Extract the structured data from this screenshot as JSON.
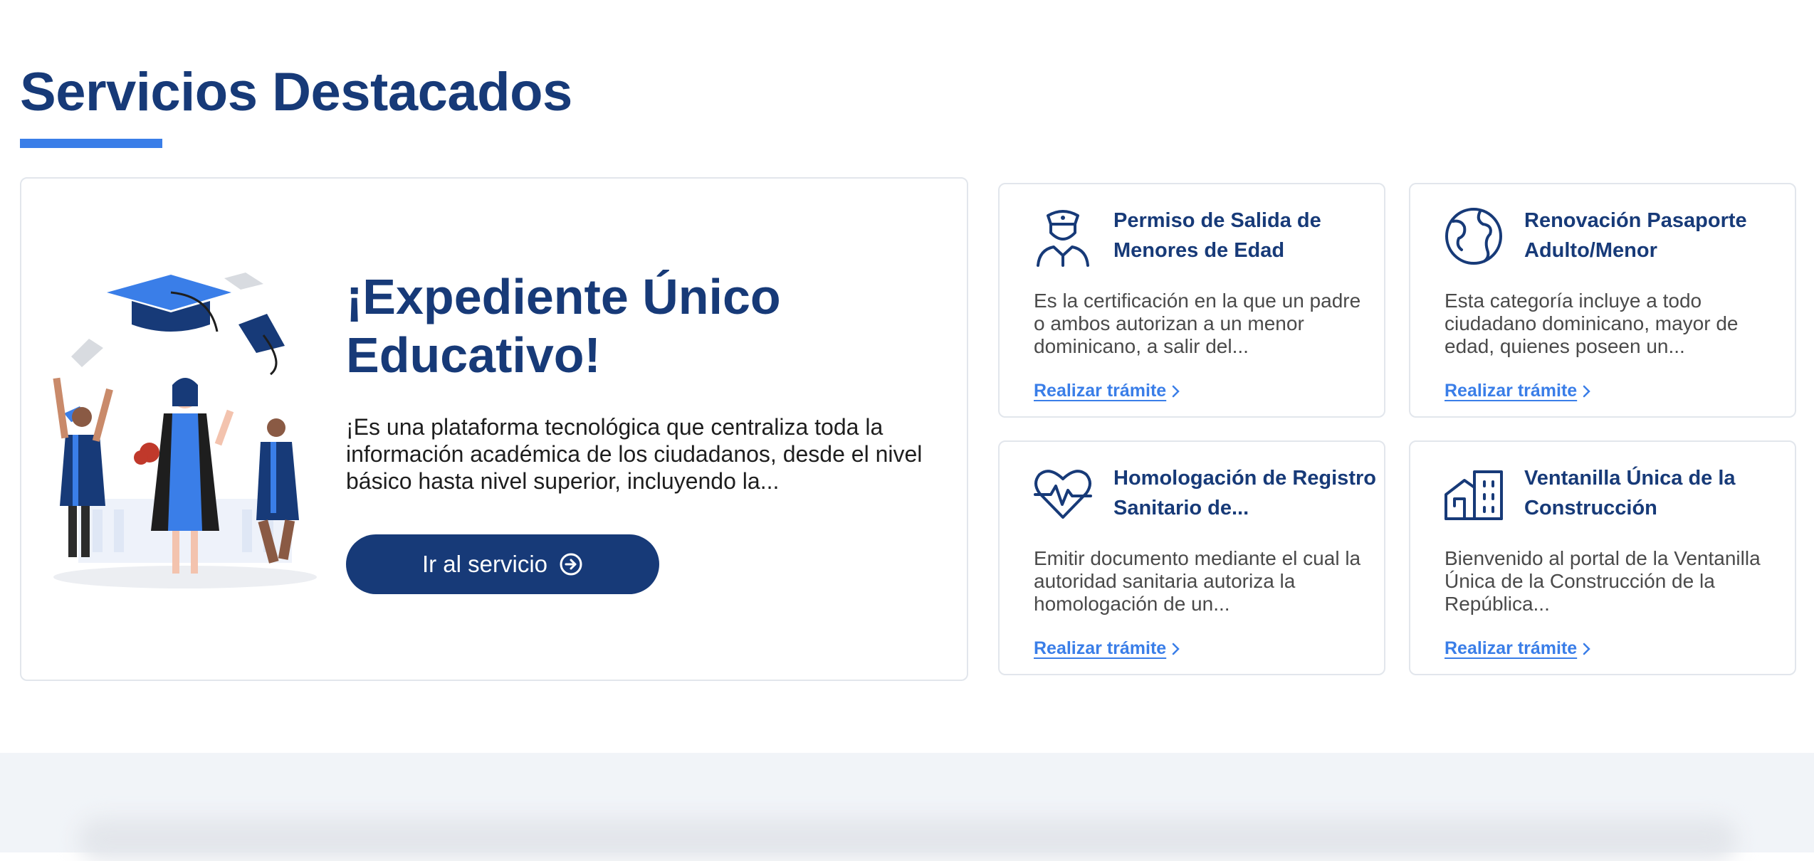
{
  "section": {
    "title": "Servicios Destacados"
  },
  "featured": {
    "title": "¡Expediente Único Educativo!",
    "description": "¡Es una plataforma tecnológica que centraliza toda la información académica de los ciudadanos, desde el nivel básico hasta nivel superior, incluyendo la...",
    "button_label": "Ir al servicio",
    "illustration": "graduation-illustration"
  },
  "services": [
    {
      "icon": "police-officer-icon",
      "title": "Permiso de Salida de Menores de Edad",
      "description": "Es la certificación en la que un padre o ambos autorizan a un menor dominicano, a salir del...",
      "link_label": "Realizar trámite"
    },
    {
      "icon": "globe-icon",
      "title": "Renovación Pasaporte Adulto/Menor",
      "description": "Esta categoría incluye a todo ciudadano dominicano, mayor de edad, quienes poseen un...",
      "link_label": "Realizar trámite"
    },
    {
      "icon": "heart-pulse-icon",
      "title": "Homologación de Registro Sanitario de...",
      "description": "Emitir documento mediante el cual la autoridad sanitaria autoriza la homologación de un...",
      "link_label": "Realizar trámite"
    },
    {
      "icon": "buildings-icon",
      "title": "Ventanilla Única de la Construcción",
      "description": "Bienvenido al portal de la Ventanilla Única de la Construcción de la República...",
      "link_label": "Realizar trámite"
    }
  ],
  "colors": {
    "primary": "#173a78",
    "accent": "#3a7ee8",
    "border": "#e2e6ec",
    "band": "#f1f4f8"
  }
}
